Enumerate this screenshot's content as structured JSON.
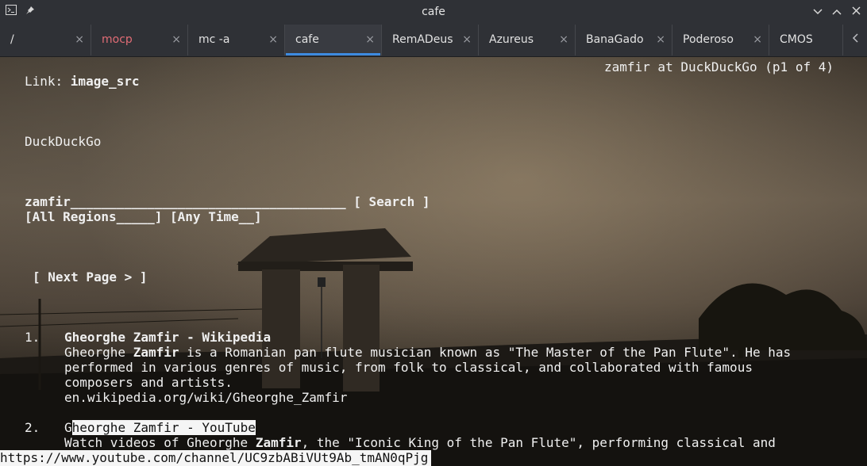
{
  "window": {
    "title": "cafe"
  },
  "tabs": [
    {
      "label": "/"
    },
    {
      "label": "mocp"
    },
    {
      "label": "mc -a"
    },
    {
      "label": "cafe"
    },
    {
      "label": "RemADeus"
    },
    {
      "label": "Azureus"
    },
    {
      "label": "BanaGado"
    },
    {
      "label": "Poderoso"
    },
    {
      "label": "CMOS"
    }
  ],
  "tab_close_glyph": "×",
  "browser": {
    "page_title": "zamfir at DuckDuckGo (p1 of 4)",
    "link_prefix": "Link: ",
    "link_name": "image_src",
    "site_name": "DuckDuckGo",
    "search_input": "zamfir____________________________________",
    "search_button": "[ Search ]",
    "region_select": "[All Regions_____]",
    "time_select": "[Any Time__]",
    "next_page": "[ Next Page > ]",
    "results": [
      {
        "number": "1.",
        "title": "Gheorghe Zamfir - Wikipedia",
        "snippet_line1_a": "Gheorghe ",
        "snippet_line1_b": "Zamfir",
        "snippet_line1_c": " is a Romanian pan flute musician known as \"The Master of the Pan Flute\". He has",
        "snippet_line2": "performed in various genres of music, from folk to classical, and collaborated with famous",
        "snippet_line3": "composers and artists.",
        "url": "en.wikipedia.org/wiki/Gheorghe_Zamfir"
      },
      {
        "number": "2.",
        "title_first": "G",
        "title_rest": "heorghe Zamfir - YouTube",
        "snippet_line1_a": "Watch videos of Gheorghe ",
        "snippet_line1_b": "Zamfir",
        "snippet_line1_c": ", the \"Iconic King of the Pan Flute\", performing classical and"
      }
    ],
    "status_url": "https://www.youtube.com/channel/UC9zbABiVUt9Ab_tmAN0qPjg"
  },
  "icons": {
    "terminal": "terminal-icon",
    "pin": "pin-icon",
    "minimize": "chevron-down-icon",
    "maximize": "chevron-up-icon",
    "close": "close-icon",
    "tab_scroll": "chevron-left-icon"
  }
}
